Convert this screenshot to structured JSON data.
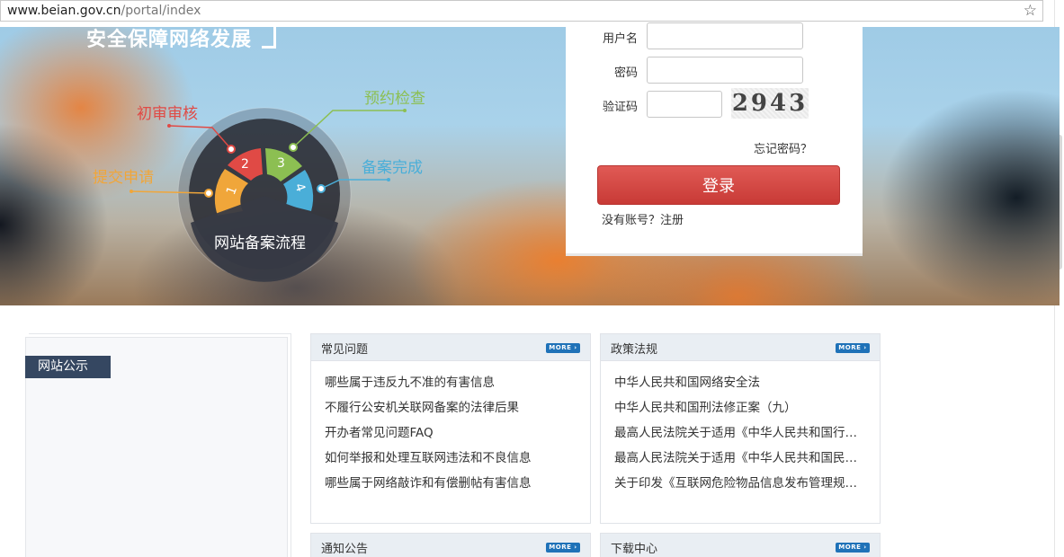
{
  "browser": {
    "url_domain": "www.beian.gov.cn",
    "url_path": "/portal/index",
    "star_icon": "star-icon"
  },
  "banner": {
    "title": "安全保障网络发展",
    "flow": {
      "title": "网站备案流程",
      "steps": [
        {
          "num": "1",
          "label": "提交申请",
          "color": "#f0a63a"
        },
        {
          "num": "2",
          "label": "初审审核",
          "color": "#e04a45"
        },
        {
          "num": "3",
          "label": "预约检查",
          "color": "#8cbf52"
        },
        {
          "num": "4",
          "label": "备案完成",
          "color": "#4aaed8"
        }
      ]
    }
  },
  "login": {
    "username_label": "用户名",
    "password_label": "密码",
    "captcha_label": "验证码",
    "captcha_text": "2943",
    "forgot": "忘记密码？",
    "button": "登录",
    "register": "没有账号？注册"
  },
  "notice": {
    "tab": "网站公示"
  },
  "faq": {
    "title": "常见问题",
    "more": "MORE",
    "items": [
      "哪些属于违反九不准的有害信息",
      "不履行公安机关联网备案的法律后果",
      "开办者常见问题FAQ",
      "如何举报和处理互联网违法和不良信息",
      "哪些属于网络敲诈和有偿删帖有害信息"
    ]
  },
  "policy": {
    "title": "政策法规",
    "more": "MORE",
    "items": [
      "中华人民共和国网络安全法",
      "中华人民共和国刑法修正案（九）",
      "最高人民法院关于适用《中华人民共和国行政诉讼法》的解释",
      "最高人民法院关于适用《中华人民共和国民事诉讼法》的解释",
      "关于印发《互联网危险物品信息发布管理规定》的通知"
    ]
  },
  "announce": {
    "title": "通知公告",
    "more": "MORE"
  },
  "download": {
    "title": "下载中心",
    "more": "MORE"
  }
}
